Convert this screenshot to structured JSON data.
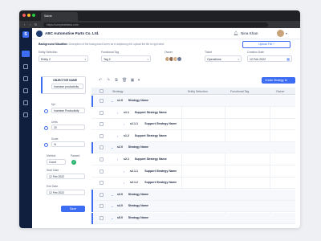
{
  "colors": {
    "accent": "#3d6df2",
    "sidebar": "#0f1f3d",
    "success": "#27b36b"
  },
  "browser": {
    "tab_title": "Salvia",
    "url": "https://complexitatea.com"
  },
  "header": {
    "company": "ABC Automotive Parts Co. Ltd.",
    "user": "Nina Khan"
  },
  "toolbar": {
    "bg_label": "Background Situation",
    "bg_description": "Rem Description of the background lorem as in adipiscing elit, upload the file to right label",
    "upload_label": "Upload File"
  },
  "filters": {
    "entity": {
      "label": "Entity Selection",
      "value": "Entity 2"
    },
    "tag": {
      "label": "Functional Tag",
      "value": "Tag 2"
    },
    "owner": {
      "label": "Owner"
    },
    "ticket": {
      "label": "Ticket",
      "value": "Operations"
    },
    "date": {
      "label": "Creation Date",
      "value": "12 Feb 2022"
    }
  },
  "objective": {
    "title": "OBJECTIVE NAME",
    "value": "Increase productivity",
    "kpi_label": "Kpi",
    "kpi_value": "Increase Productivity",
    "units_label": "Units",
    "units_value": "20",
    "scale_label": "Scale",
    "scale_value": "%",
    "method_label": "Method",
    "method_value": "Count",
    "passed_label": "Passed",
    "start_label": "Start Date",
    "start_value": "12 Feb 2022",
    "end_label": "End Date",
    "end_value": "12 Feb 2022",
    "save_label": "Save"
  },
  "grid": {
    "create_label": "Create Strategy",
    "columns": [
      "Strategy",
      "Entity Selection",
      "Functional Tag",
      "Owner"
    ],
    "rows": [
      {
        "id": "s1.0",
        "name": "Strategy Name",
        "level": 0
      },
      {
        "id": "s1.1",
        "name": "Support Strategy Name",
        "level": 1
      },
      {
        "id": "s1.1.1",
        "name": "Support Strategy Name",
        "level": 2
      },
      {
        "id": "s1.2",
        "name": "Support Strategy Name",
        "level": 1
      },
      {
        "id": "s2.0",
        "name": "Strategy Name",
        "level": 0
      },
      {
        "id": "s2.1",
        "name": "Support Strategy Name",
        "level": 1
      },
      {
        "id": "s2.1.1",
        "name": "Support Strategy Name",
        "level": 2
      },
      {
        "id": "s2.1.2",
        "name": "Support Strategy Name",
        "level": 2
      },
      {
        "id": "s3.0",
        "name": "Strategy Name",
        "level": 0
      },
      {
        "id": "s4.0",
        "name": "Strategy Name",
        "level": 0
      },
      {
        "id": "s5.0",
        "name": "Strategy Name",
        "level": 0
      }
    ]
  }
}
